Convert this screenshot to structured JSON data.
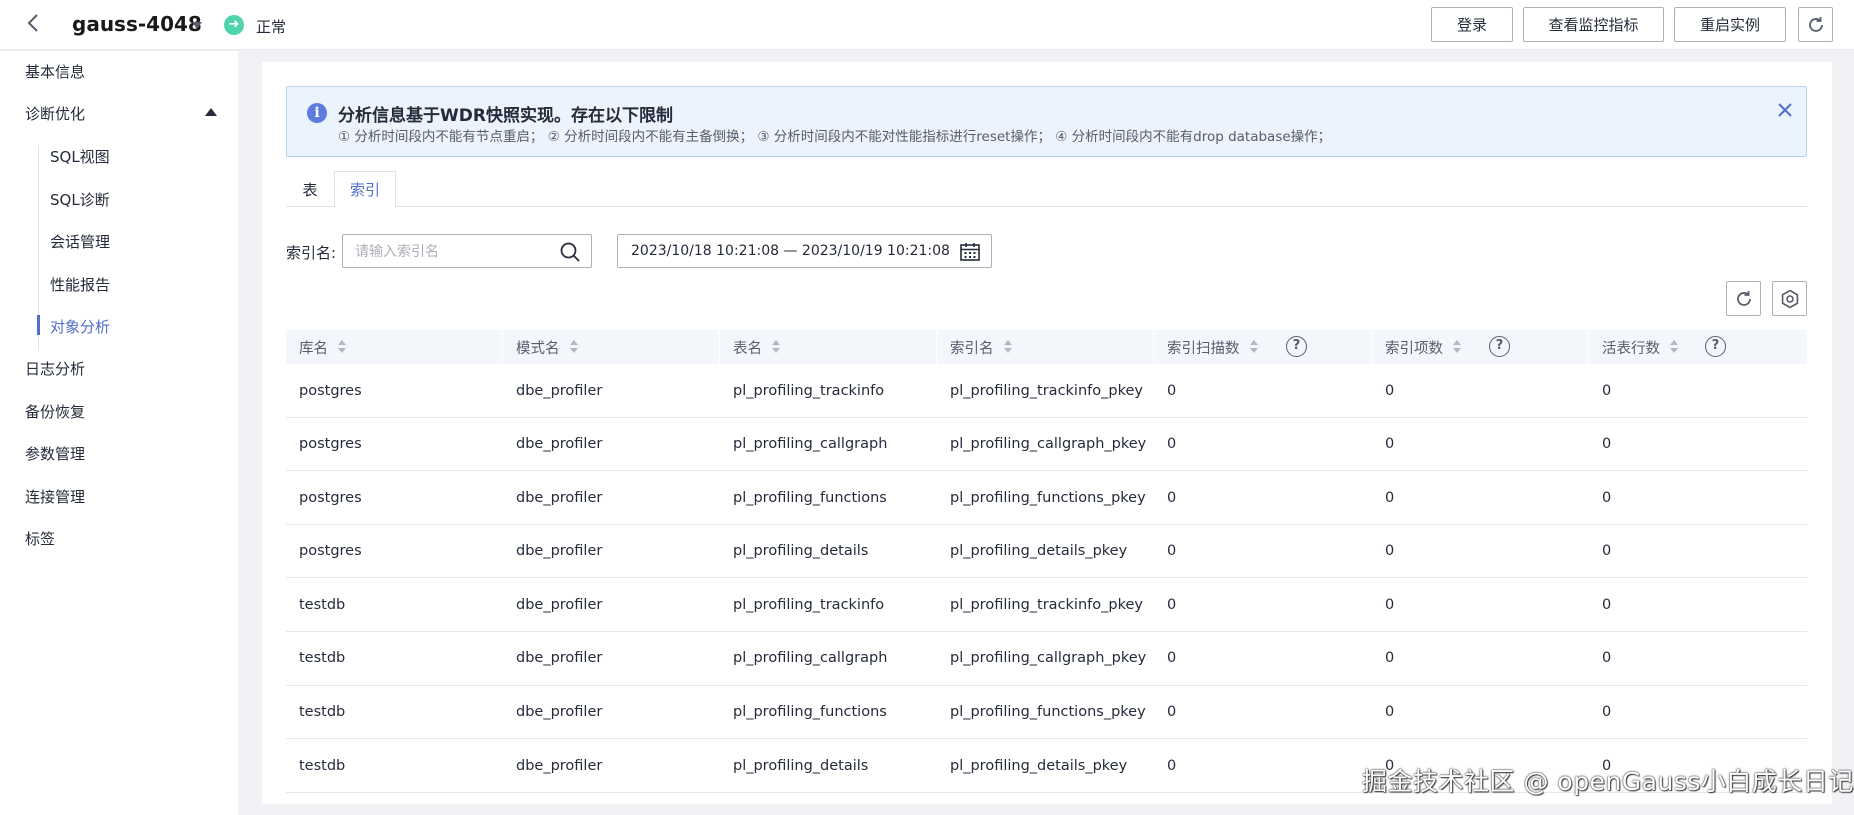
{
  "header": {
    "instance_name": "gauss-4048",
    "status": "正常",
    "buttons": {
      "login": "登录",
      "monitor": "查看监控指标",
      "restart": "重启实例"
    }
  },
  "sidebar": {
    "items": [
      {
        "label": "基本信息"
      },
      {
        "label": "诊断优化"
      },
      {
        "label": "日志分析"
      },
      {
        "label": "备份恢复"
      },
      {
        "label": "参数管理"
      },
      {
        "label": "连接管理"
      },
      {
        "label": "标签"
      }
    ],
    "sub_items": [
      {
        "label": "SQL视图"
      },
      {
        "label": "SQL诊断"
      },
      {
        "label": "会话管理"
      },
      {
        "label": "性能报告"
      },
      {
        "label": "对象分析",
        "active": true
      }
    ]
  },
  "notice": {
    "title": "分析信息基于WDR快照实现。存在以下限制",
    "desc": "① 分析时间段内不能有节点重启；  ② 分析时间段内不能有主备倒换；  ③ 分析时间段内不能对性能指标进行reset操作；  ④ 分析时间段内不能有drop  database操作；"
  },
  "tabs": [
    {
      "label": "表"
    },
    {
      "label": "索引",
      "active": true
    }
  ],
  "filter": {
    "label": "索引名:",
    "placeholder": "请输入索引名",
    "date_range": "2023/10/18  10:21:08  —  2023/10/19  10:21:08"
  },
  "table": {
    "columns": [
      "库名",
      "模式名",
      "表名",
      "索引名",
      "索引扫描数",
      "索引项数",
      "活表行数"
    ],
    "rows": [
      [
        "postgres",
        "dbe_profiler",
        "pl_profiling_trackinfo",
        "pl_profiling_trackinfo_pkey",
        "0",
        "0",
        "0"
      ],
      [
        "postgres",
        "dbe_profiler",
        "pl_profiling_callgraph",
        "pl_profiling_callgraph_pkey",
        "0",
        "0",
        "0"
      ],
      [
        "postgres",
        "dbe_profiler",
        "pl_profiling_functions",
        "pl_profiling_functions_pkey",
        "0",
        "0",
        "0"
      ],
      [
        "postgres",
        "dbe_profiler",
        "pl_profiling_details",
        "pl_profiling_details_pkey",
        "0",
        "0",
        "0"
      ],
      [
        "testdb",
        "dbe_profiler",
        "pl_profiling_trackinfo",
        "pl_profiling_trackinfo_pkey",
        "0",
        "0",
        "0"
      ],
      [
        "testdb",
        "dbe_profiler",
        "pl_profiling_callgraph",
        "pl_profiling_callgraph_pkey",
        "0",
        "0",
        "0"
      ],
      [
        "testdb",
        "dbe_profiler",
        "pl_profiling_functions",
        "pl_profiling_functions_pkey",
        "0",
        "0",
        "0"
      ],
      [
        "testdb",
        "dbe_profiler",
        "pl_profiling_details",
        "pl_profiling_details_pkey",
        "0",
        "0",
        "0"
      ]
    ]
  },
  "watermark": "掘金技术社区 @ openGauss小白成长日记",
  "colors": {
    "accent": "#526ecc",
    "status_ok": "#50d4ab",
    "notice_bg": "#ebf3fc"
  }
}
